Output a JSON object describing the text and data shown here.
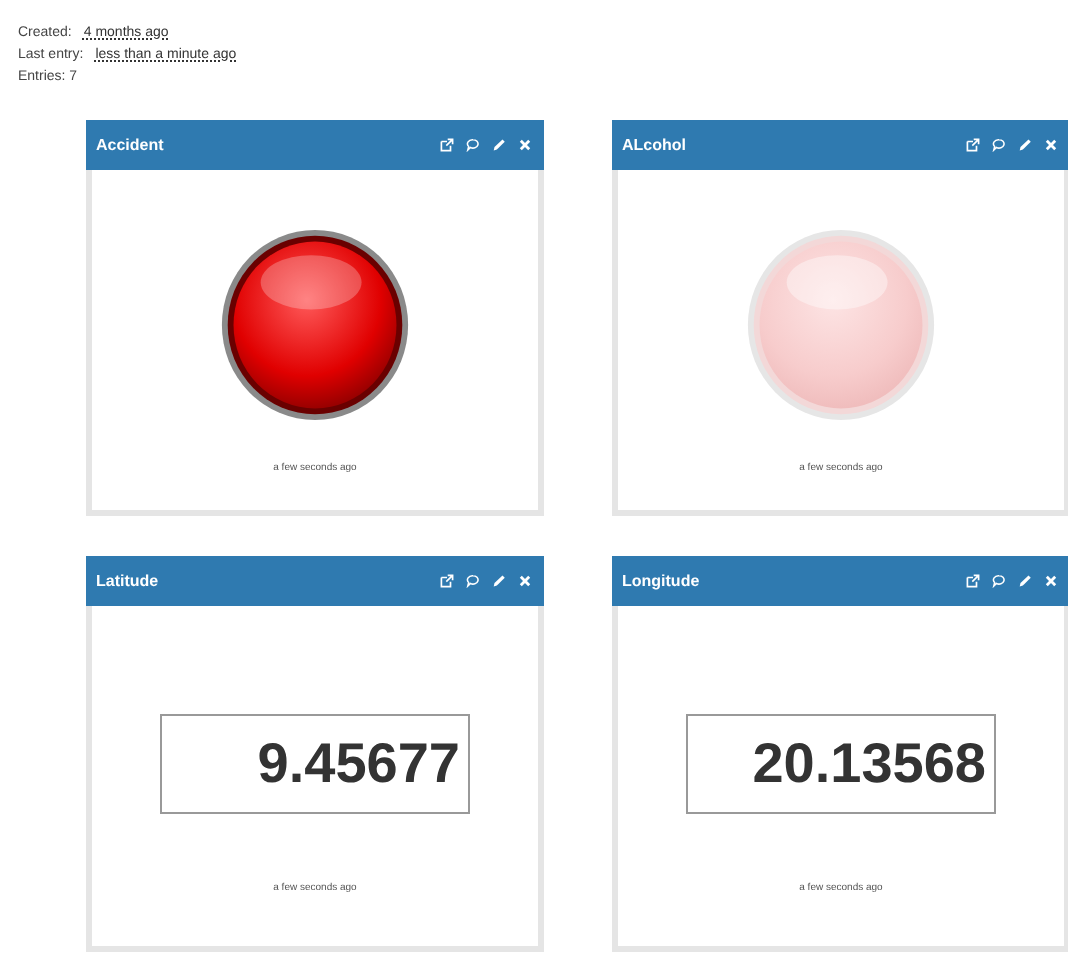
{
  "meta": [
    {
      "label": "Created:",
      "value": "4 months ago"
    },
    {
      "label": "Last entry:",
      "value": "less than a minute ago"
    },
    {
      "label": "Entries: 7"
    }
  ],
  "widgets": [
    {
      "title": "Accident",
      "kind": "led",
      "on": true,
      "updated": "a few seconds ago"
    },
    {
      "title": "ALcohol",
      "kind": "led",
      "on": false,
      "updated": "a few seconds ago"
    },
    {
      "title": "Latitude",
      "kind": "display",
      "value": "9.45677",
      "updated": "a few seconds ago"
    },
    {
      "title": "Longitude",
      "kind": "display",
      "value": "20.13568",
      "updated": "a few seconds ago"
    }
  ]
}
